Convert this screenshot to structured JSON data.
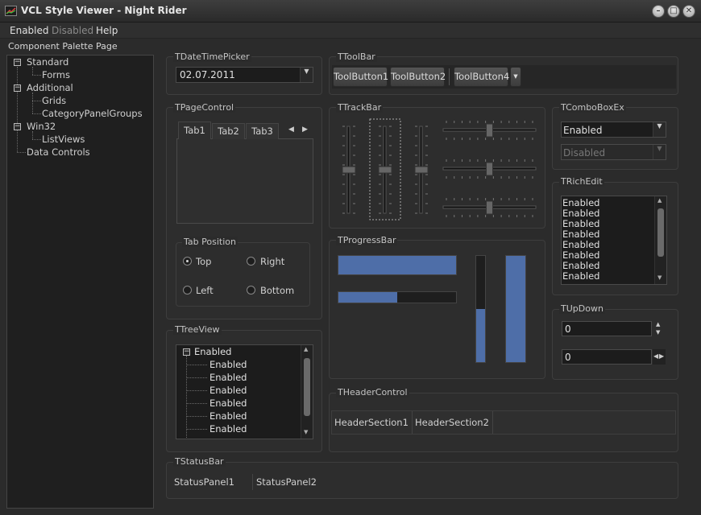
{
  "window": {
    "title": "VCL Style Viewer - Night Rider",
    "buttons": [
      "minimize-icon",
      "maximize-icon",
      "close-icon"
    ]
  },
  "menu": {
    "enabled": "Enabled",
    "disabled": "Disabled",
    "help": "Help"
  },
  "left_label": "Component Palette Page",
  "tree": {
    "items": [
      {
        "label": "Standard",
        "expanded": true
      },
      {
        "label": "Forms"
      },
      {
        "label": "Additional",
        "expanded": true
      },
      {
        "label": "Grids"
      },
      {
        "label": "CategoryPanelGroups"
      },
      {
        "label": "Win32",
        "expanded": true
      },
      {
        "label": "ListViews"
      },
      {
        "label": "Data Controls"
      }
    ]
  },
  "dtp": {
    "caption": "TDateTimePicker",
    "value": "02.07.2011"
  },
  "toolbar": {
    "caption": "TToolBar",
    "buttons": [
      "ToolButton1",
      "ToolButton2",
      "ToolButton4"
    ]
  },
  "pagecontrol": {
    "caption": "TPageControl",
    "tabs": [
      "Tab1",
      "Tab2",
      "Tab3"
    ]
  },
  "tabpos": {
    "caption": "Tab Position",
    "options": [
      "Top",
      "Right",
      "Left",
      "Bottom"
    ],
    "selected": "Top"
  },
  "treeview": {
    "caption": "TTreeView",
    "root": "Enabled",
    "children": [
      "Enabled",
      "Enabled",
      "Enabled",
      "Enabled",
      "Enabled",
      "Enabled"
    ]
  },
  "trackbar": {
    "caption": "TTrackBar",
    "vertical_positions": [
      0.5,
      0.5,
      0.5
    ],
    "horizontal_positions": [
      0.5,
      0.5,
      0.5
    ]
  },
  "progressbar": {
    "caption": "TProgressBar",
    "h1": 1.0,
    "h2": 0.5,
    "v1": 0.5,
    "v2": 1.0
  },
  "comboex": {
    "caption": "TComboBoxEx",
    "enabled": "Enabled",
    "disabled": "Disabled"
  },
  "richedit": {
    "caption": "TRichEdit",
    "lines": [
      "Enabled",
      "Enabled",
      "Enabled",
      "Enabled",
      "Enabled",
      "Enabled",
      "Enabled",
      "Enabled"
    ]
  },
  "updown": {
    "caption": "TUpDown",
    "value1": "0",
    "value2": "0"
  },
  "header": {
    "caption": "THeaderControl",
    "sections": [
      "HeaderSection1",
      "HeaderSection2"
    ]
  },
  "statusbar": {
    "caption": "TStatusBar",
    "panels": [
      "StatusPanel1",
      "StatusPanel2"
    ]
  },
  "colors": {
    "accent": "#4e6ea8",
    "background": "#2b2b2b"
  }
}
